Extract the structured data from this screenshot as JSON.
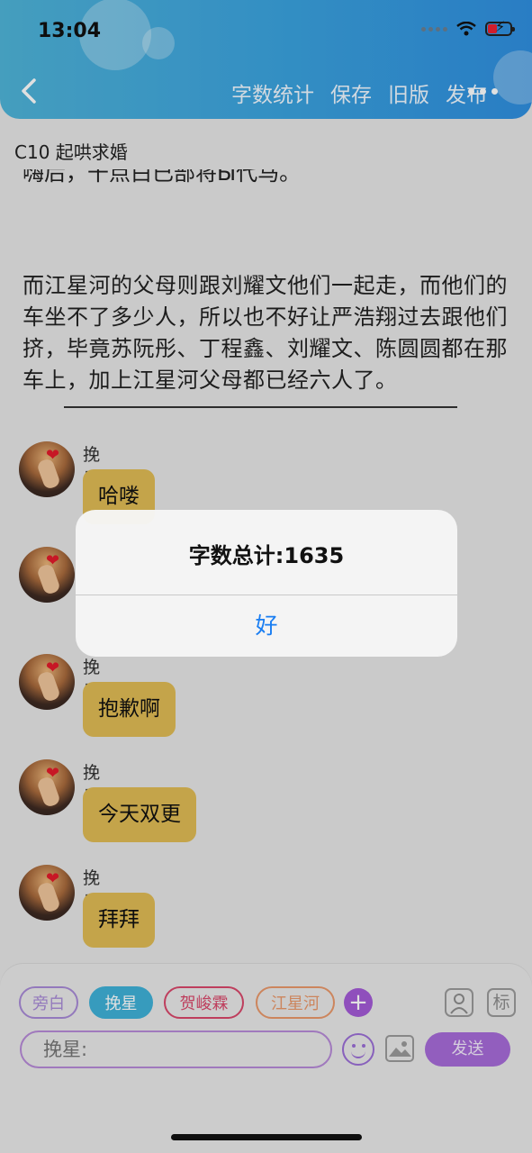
{
  "status_bar": {
    "time": "13:04"
  },
  "header": {
    "nav": [
      "字数统计",
      "保存",
      "旧版",
      "发布"
    ]
  },
  "chapter": {
    "title": "C10 起哄求婚"
  },
  "story": {
    "clipped_line": "嗨后，干点白已部将Ы代马。",
    "paragraph": "而江星河的父母则跟刘耀文他们一起走，而他们的车坐不了多少人，所以也不好让严浩翔过去跟他们挤，毕竟苏阮彤、丁程鑫、刘耀文、陈圆圆都在那车上，加上江星河父母都已经六人了。"
  },
  "messages": [
    {
      "sender": "挽星",
      "text": "哈喽"
    },
    {
      "sender": "挽星",
      "text": ""
    },
    {
      "sender": "挽星",
      "text": "抱歉啊"
    },
    {
      "sender": "挽星",
      "text": "今天双更"
    },
    {
      "sender": "挽星",
      "text": "拜拜"
    }
  ],
  "alert": {
    "message": "字数总计:1635",
    "ok_label": "好"
  },
  "composer": {
    "roles": [
      {
        "label": "旁白",
        "color": "#a88ad6"
      },
      {
        "label": "挽星",
        "color": "#3fb1d8"
      },
      {
        "label": "贺峻霖",
        "color": "#d9476a"
      },
      {
        "label": "江星河",
        "color": "#e9986a"
      }
    ],
    "tag_label": "标",
    "placeholder": "挽星:",
    "send_label": "发送"
  }
}
